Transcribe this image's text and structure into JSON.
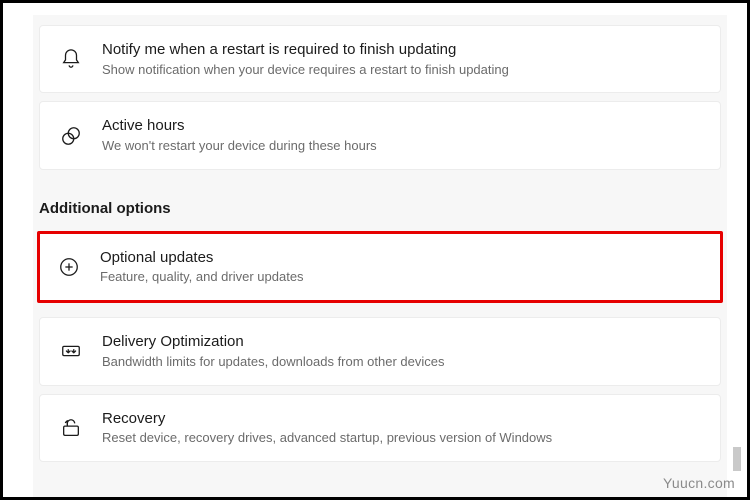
{
  "cards": {
    "notify": {
      "title": "Notify me when a restart is required to finish updating",
      "sub": "Show notification when your device requires a restart to finish updating"
    },
    "active_hours": {
      "title": "Active hours",
      "sub": "We won't restart your device during these hours"
    },
    "optional_updates": {
      "title": "Optional updates",
      "sub": "Feature, quality, and driver updates"
    },
    "delivery_optimization": {
      "title": "Delivery Optimization",
      "sub": "Bandwidth limits for updates, downloads from other devices"
    },
    "recovery": {
      "title": "Recovery",
      "sub": "Reset device, recovery drives, advanced startup, previous version of Windows"
    }
  },
  "section_header": "Additional options",
  "watermark": "Yuucn.com"
}
